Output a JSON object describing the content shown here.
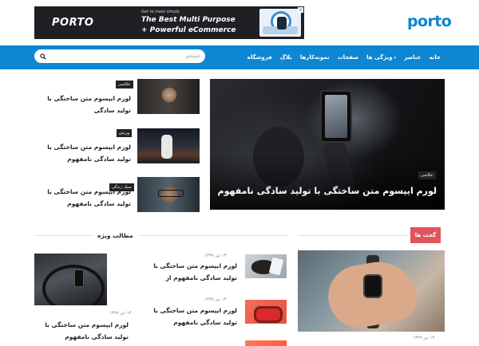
{
  "banner": {
    "brand": "PORTO",
    "small_text": "Get to meet simply",
    "line1": "The Best Multi Purpose",
    "line2": "+ Powerful eCommerce",
    "close_label": "x"
  },
  "logo": {
    "text": "porto"
  },
  "nav": {
    "items": [
      {
        "label": "خانه",
        "has_dropdown": false
      },
      {
        "label": "عناصر",
        "has_dropdown": false
      },
      {
        "label": "ویژگی ها",
        "has_dropdown": true
      },
      {
        "label": "صفحات",
        "has_dropdown": false
      },
      {
        "label": "نمونه‌کارها",
        "has_dropdown": false
      },
      {
        "label": "بلاگ",
        "has_dropdown": false
      },
      {
        "label": "فروشگاه",
        "has_dropdown": false
      }
    ],
    "dropdown_glyph": "▾"
  },
  "search": {
    "placeholder": "جستجو",
    "value": "",
    "icon": "search-icon"
  },
  "hero": {
    "tag": "عکاسی",
    "title": "لورم ایپسوم متن ساختگی با تولید سادگی نامفهوم"
  },
  "side_posts": [
    {
      "tag": "عکاسی",
      "title": "لورم ایپسوم متن ساختگی با تولید سادگی"
    },
    {
      "tag": "ورزش",
      "title": "لورم ایپسوم متن ساختگی با تولید سادگی نامفهوم"
    },
    {
      "tag": "سبک زندگی",
      "title": "لورم ایپسوم متن ساختگی با تولید سادگی نامفهوم"
    }
  ],
  "sections": {
    "gadgets": "گجت ها",
    "special": "مطالب ویژه"
  },
  "gadget_big": {
    "date": "۱۳ تیر ۱۳۹۹"
  },
  "gadget_list": [
    {
      "date": "۱۳ تیر ۱۳۹۹",
      "title": "لورم ایپسوم متن ساختگی با تولید سادگی نامفهوم از"
    },
    {
      "date": "۱۳ تیر ۱۳۹۹",
      "title": "لورم ایپسوم متن ساختگی با تولید سادگی نامفهوم"
    },
    {
      "date": "",
      "title": ""
    }
  ],
  "special_post": {
    "date": "۱۳ تیر ۱۳۹۹",
    "title": "لورم ایپسوم متن ساختگی با تولید سادگی نامفهوم"
  },
  "colors": {
    "nav_bg": "#0d87d2",
    "logo": "#0e85cf",
    "gadgets_tag": "#e0555b",
    "tag_bg": "#222222"
  }
}
